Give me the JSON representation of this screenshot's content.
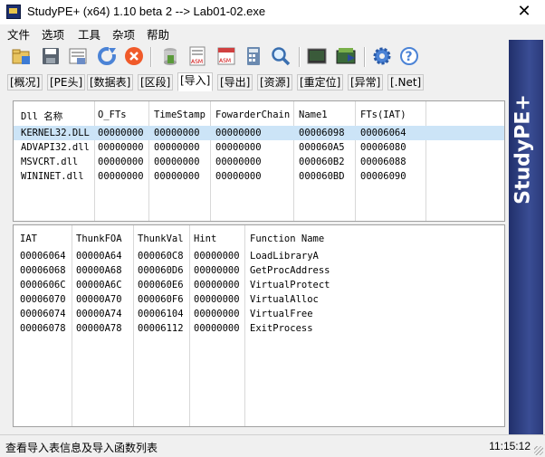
{
  "window": {
    "title": "StudyPE+ (x64) 1.10 beta 2  --> Lab01-02.exe"
  },
  "menu": [
    "文件",
    "选项",
    "工具",
    "杂项",
    "帮助"
  ],
  "toolbar": {
    "buttons": [
      "open-file-icon",
      "save-icon",
      "print-preview-icon",
      "refresh-icon",
      "close-file-icon",
      "database-icon",
      "asm-icon",
      "asm-icon",
      "calculator-icon",
      "search-icon",
      "terminal-icon",
      "packer-icon",
      "gear-icon",
      "help-icon"
    ]
  },
  "tabs": [
    "[概况]",
    "[PE头]",
    "[数据表]",
    "[区段]",
    "[导入]",
    "[导出]",
    "[资源]",
    "[重定位]",
    "[异常]",
    "[.Net]"
  ],
  "active_tab": "[导入]",
  "brand": "StudyPE+",
  "dll_table": {
    "headers": [
      "Dll 名称",
      "O_FTs",
      "TimeStamp",
      "FowarderChain",
      "Name1",
      "FTs(IAT)"
    ],
    "rows": [
      [
        "KERNEL32.DLL",
        "00000000",
        "00000000",
        "00000000",
        "00006098",
        "00006064"
      ],
      [
        "ADVAPI32.dll",
        "00000000",
        "00000000",
        "00000000",
        "000060A5",
        "00006080"
      ],
      [
        "MSVCRT.dll",
        "00000000",
        "00000000",
        "00000000",
        "000060B2",
        "00006088"
      ],
      [
        "WININET.dll",
        "00000000",
        "00000000",
        "00000000",
        "000060BD",
        "00006090"
      ]
    ]
  },
  "func_table": {
    "headers": [
      "IAT",
      "ThunkFOA",
      "ThunkVal",
      "Hint",
      "Function Name"
    ],
    "rows": [
      [
        "00006064",
        "00000A64",
        "000060C8",
        "00000000",
        "LoadLibraryA"
      ],
      [
        "00006068",
        "00000A68",
        "000060D6",
        "00000000",
        "GetProcAddress"
      ],
      [
        "0000606C",
        "00000A6C",
        "000060E6",
        "00000000",
        "VirtualProtect"
      ],
      [
        "00006070",
        "00000A70",
        "000060F6",
        "00000000",
        "VirtualAlloc"
      ],
      [
        "00006074",
        "00000A74",
        "00006104",
        "00000000",
        "VirtualFree"
      ],
      [
        "00006078",
        "00000A78",
        "00006112",
        "00000000",
        "ExitProcess"
      ]
    ]
  },
  "status": {
    "text": "查看导入表信息及导入函数列表",
    "time": "11:15:12"
  }
}
